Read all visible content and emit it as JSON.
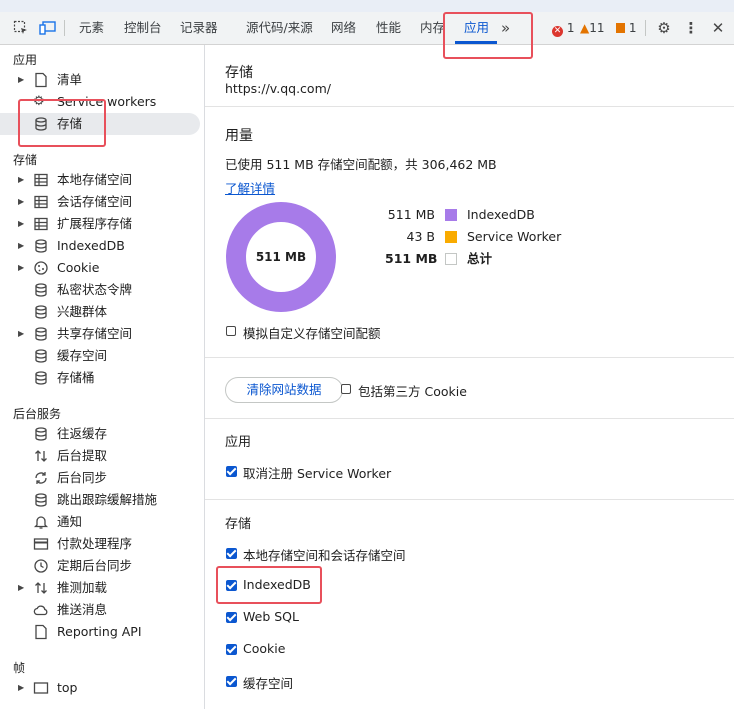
{
  "toolbar": {
    "tabs": [
      "元素",
      "控制台",
      "记录器",
      "源代码/来源",
      "网络",
      "性能",
      "内存",
      "应用"
    ],
    "more": "»",
    "errors": "1",
    "warnings": "11",
    "issues": "1",
    "inspect_icon": "inspect-element-icon",
    "device_icon": "device-toggle-icon"
  },
  "sidebar": {
    "app_header": "应用",
    "app_items": [
      "清单",
      "Service workers",
      "存储"
    ],
    "storage_header": "存储",
    "storage_items": [
      "本地存储空间",
      "会话存储空间",
      "扩展程序存储",
      "IndexedDB",
      "Cookie",
      "私密状态令牌",
      "兴趣群体",
      "共享存储空间",
      "缓存空间",
      "存储桶"
    ],
    "bg_header": "后台服务",
    "bg_items": [
      "往返缓存",
      "后台提取",
      "后台同步",
      "跳出跟踪缓解措施",
      "通知",
      "付款处理程序",
      "定期后台同步",
      "推测加载",
      "推送消息",
      "Reporting API"
    ],
    "frames_header": "帧",
    "frames_items": [
      "top"
    ]
  },
  "main": {
    "title": "存储",
    "origin": "https://v.qq.com/",
    "usage_title": "用量",
    "usage_text": "已使用 511 MB 存储空间配额，共 306,462 MB",
    "learn_more": "了解详情",
    "donut_label": "511 MB",
    "legend": [
      {
        "value": "511 MB",
        "name": "IndexedDB",
        "color": "#a77be9"
      },
      {
        "value": "43 B",
        "name": "Service Worker",
        "color": "#f9ab00"
      },
      {
        "value": "511 MB",
        "name": "总计",
        "color": "#ffffff"
      }
    ],
    "simulate_quota": "模拟自定义存储空间配额",
    "clear_button": "清除网站数据",
    "include_third_party": "包括第三方 Cookie",
    "app_section": "应用",
    "unregister_sw": "取消注册 Service Worker",
    "storage_section": "存储",
    "storage_checks": [
      "本地存储空间和会话存储空间",
      "IndexedDB",
      "Web SQL",
      "Cookie",
      "缓存空间"
    ]
  },
  "chart_data": {
    "type": "pie",
    "categories": [
      "IndexedDB",
      "Service Worker"
    ],
    "values": [
      511,
      4.3e-05
    ],
    "unit": "MB"
  },
  "colors": {
    "accent": "#0b57d0",
    "highlight": "#e8505b"
  }
}
